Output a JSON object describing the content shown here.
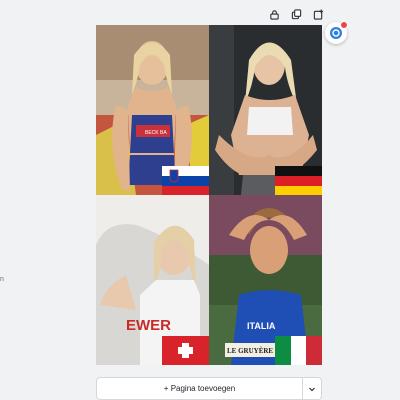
{
  "left_edge_text": "n",
  "toolbar": {
    "lock_icon": "lock-icon",
    "duplicate_icon": "duplicate-page-icon",
    "add_icon": "add-page-icon"
  },
  "assistant": {
    "icon": "magic-assistant-icon",
    "badge_color": "#e5484d"
  },
  "page": {
    "photos": [
      {
        "name": "photo-top-left",
        "jersey_text": "BECK BA",
        "flag": "Slovenia"
      },
      {
        "name": "photo-top-right",
        "flag": "Germany"
      },
      {
        "name": "photo-bottom-left",
        "jersey_text": "EWER",
        "flag": "Switzerland"
      },
      {
        "name": "photo-bottom-right",
        "jersey_text": "ITALIA",
        "sponsor_text": "LE GRUYÈRE",
        "flag": "Italy"
      }
    ]
  },
  "add_page": {
    "label": "+ Pagina toevoegen",
    "caret_icon": "chevron-down-icon"
  }
}
